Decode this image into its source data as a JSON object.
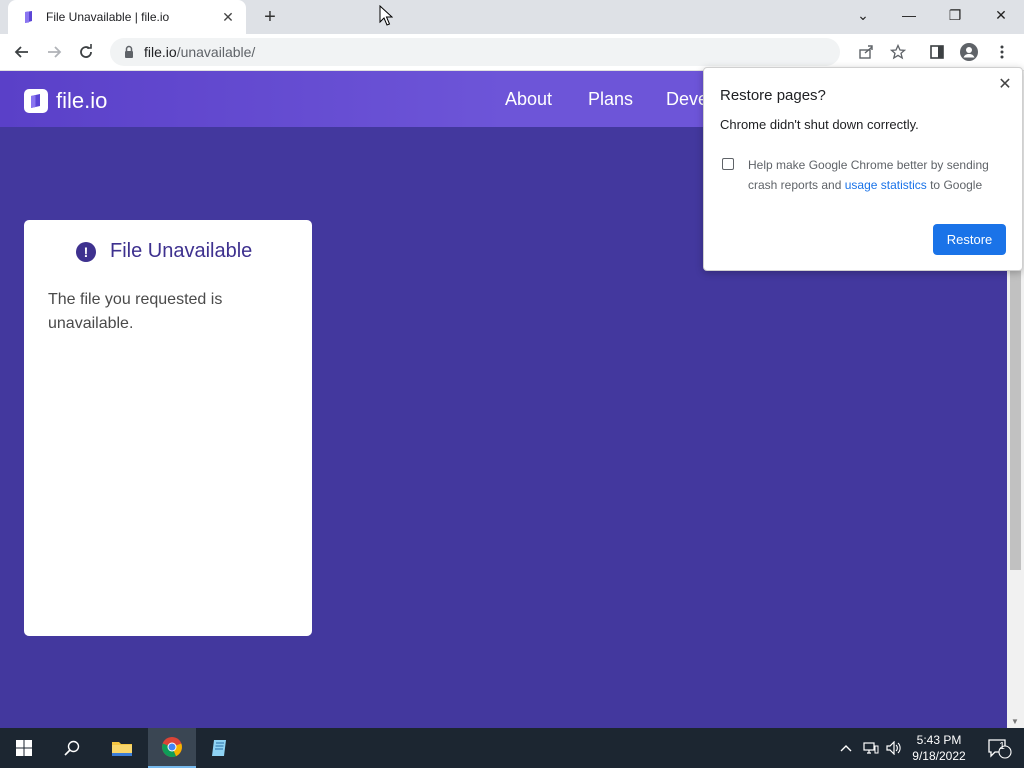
{
  "browser": {
    "tab": {
      "title": "File Unavailable | file.io",
      "close": "✕"
    },
    "new_tab": "+",
    "window_controls": {
      "minimize": "—",
      "maximize": "❐",
      "close": "✕",
      "tab_search": "⌄"
    },
    "address_bar": {
      "host": "file.io",
      "path": "/unavailable/"
    }
  },
  "site": {
    "logo": "file.io",
    "nav": [
      "About",
      "Plans",
      "Deve"
    ],
    "card": {
      "title": "File Unavailable",
      "message": "The file you requested is unavailable."
    }
  },
  "restore_popup": {
    "title": "Restore pages?",
    "message": "Chrome didn't shut down correctly.",
    "checkbox_label_prefix": "Help make Google Chrome better by sending crash reports and ",
    "checkbox_link": "usage statistics",
    "checkbox_label_suffix": " to Google",
    "button": "Restore",
    "checked": false
  },
  "taskbar": {
    "time": "5:43 PM",
    "date": "9/18/2022",
    "notification_count": "1"
  },
  "colors": {
    "page_bg": "#43389e",
    "header_bg": "#6d55d8",
    "accent_blue": "#1a73e8",
    "card_title": "#3e318f"
  }
}
